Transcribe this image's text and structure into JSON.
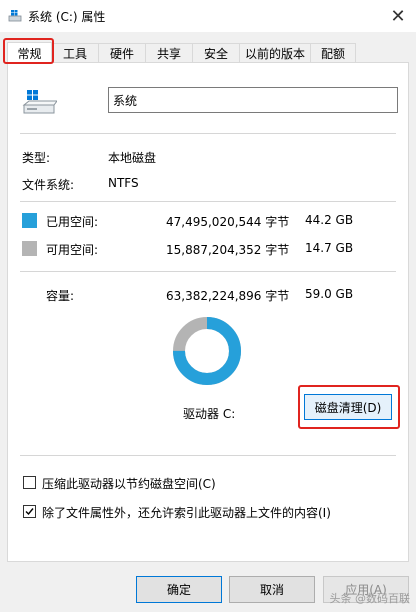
{
  "window": {
    "title": "系统 (C:) 属性",
    "close_glyph": "✕"
  },
  "tabs": [
    {
      "label": "常规",
      "active": true
    },
    {
      "label": "工具"
    },
    {
      "label": "硬件"
    },
    {
      "label": "共享"
    },
    {
      "label": "安全"
    },
    {
      "label": "以前的版本"
    },
    {
      "label": "配额"
    }
  ],
  "general": {
    "drive_name": "系统",
    "type_label": "类型:",
    "type_value": "本地磁盘",
    "fs_label": "文件系统:",
    "fs_value": "NTFS",
    "used": {
      "label": "已用空间:",
      "bytes": "47,495,020,544 字节",
      "size": "44.2 GB",
      "color": "#26a0da"
    },
    "free": {
      "label": "可用空间:",
      "bytes": "15,887,204,352 字节",
      "size": "14.7 GB",
      "color": "#b4b4b4"
    },
    "capacity": {
      "label": "容量:",
      "bytes": "63,382,224,896 字节",
      "size": "59.0 GB"
    },
    "drive_label": "驱动器 C:",
    "cleanup_button": "磁盘清理(D)",
    "compress_option": {
      "label": "压缩此驱动器以节约磁盘空间(C)",
      "checked": false
    },
    "index_option": {
      "label": "除了文件属性外，还允许索引此驱动器上文件的内容(I)",
      "checked": true
    }
  },
  "buttons": {
    "ok": "确定",
    "cancel": "取消",
    "apply": "应用(A)"
  },
  "watermark": "头条 @数码百联"
}
